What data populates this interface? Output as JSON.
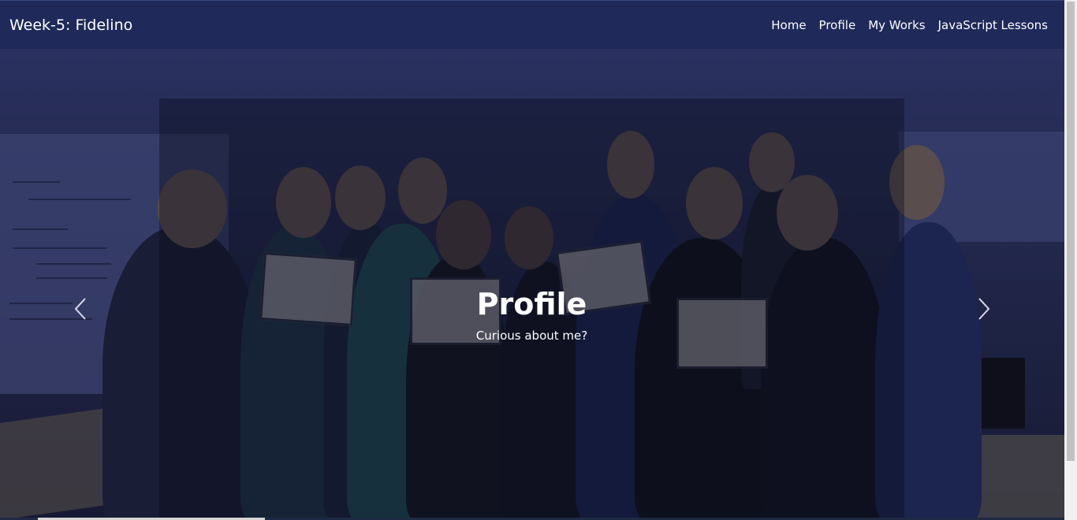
{
  "navbar": {
    "brand": "Week-5: Fidelino",
    "links": [
      {
        "label": "Home"
      },
      {
        "label": "Profile"
      },
      {
        "label": "My Works"
      },
      {
        "label": "JavaScript Lessons"
      }
    ]
  },
  "carousel": {
    "title": "Profile",
    "subtitle": "Curious about me?",
    "prev_icon": "chevron-left-icon",
    "next_icon": "chevron-right-icon"
  },
  "colors": {
    "navbar_bg": "#1f2a5a",
    "overlay": "#1f2446",
    "text": "#ffffff"
  }
}
